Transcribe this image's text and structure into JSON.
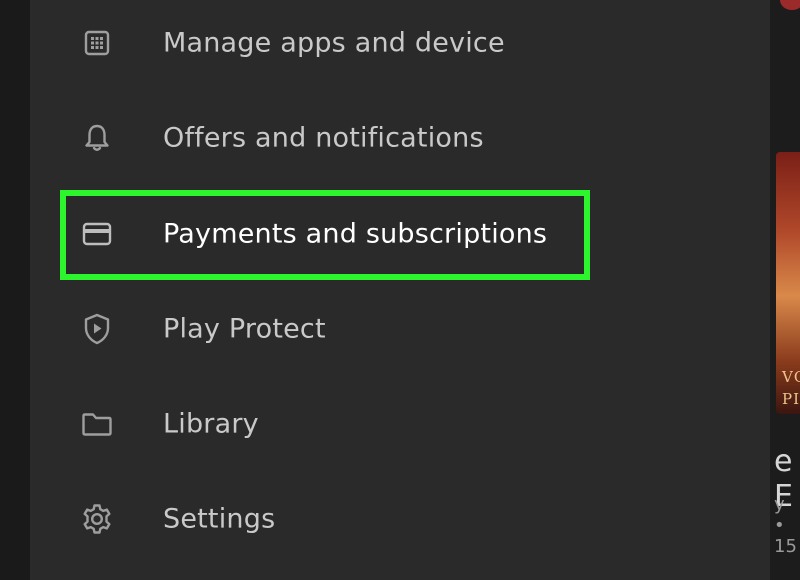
{
  "menu": {
    "items": [
      {
        "label": "Manage apps and device",
        "icon": "grid-icon"
      },
      {
        "label": "Offers and notifications",
        "icon": "bell-icon"
      },
      {
        "label": "Payments and subscriptions",
        "icon": "credit-card-icon",
        "highlighted": true
      },
      {
        "label": "Play Protect",
        "icon": "play-protect-shield-icon"
      },
      {
        "label": "Library",
        "icon": "folder-icon"
      },
      {
        "label": "Settings",
        "icon": "gear-icon"
      }
    ]
  },
  "background": {
    "peek_lines": [
      "VC",
      "PI",
      "e E",
      "y •",
      "15"
    ]
  },
  "colors": {
    "drawer_bg": "#2a2a2a",
    "icon": "#9e9e9e",
    "label": "#c9c9c9",
    "highlight_border": "#2df52d"
  }
}
